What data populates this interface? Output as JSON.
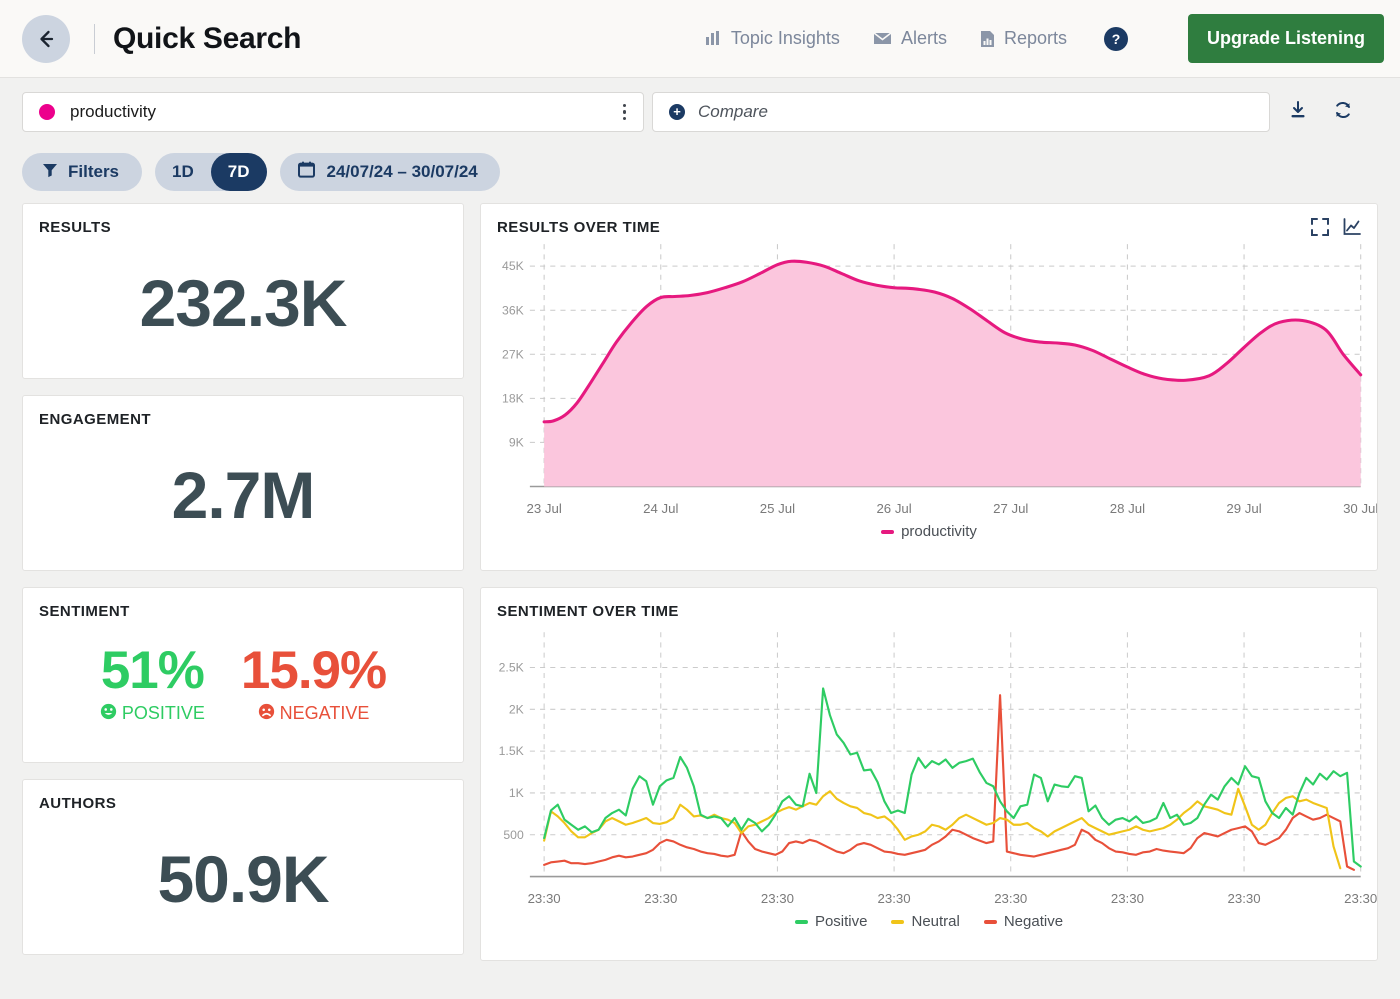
{
  "header": {
    "back_icon": "arrow-left-icon",
    "title": "Quick Search",
    "nav": [
      {
        "label": "Topic Insights",
        "icon": "bar-chart-icon"
      },
      {
        "label": "Alerts",
        "icon": "envelope-icon"
      },
      {
        "label": "Reports",
        "icon": "document-chart-icon"
      }
    ],
    "help_label": "?",
    "upgrade_label": "Upgrade Listening"
  },
  "search": {
    "term": "productivity",
    "term_color": "#ec008c",
    "menu_icon": "kebab-menu-icon",
    "compare_placeholder": "Compare",
    "compare_icon": "plus-circle-icon",
    "download_icon": "download-icon",
    "refresh_icon": "refresh-icon"
  },
  "filters": {
    "filters_label": "Filters",
    "filter_icon": "funnel-icon",
    "range_1d": "1D",
    "range_7d": "7D",
    "active_range": "7D",
    "calendar_icon": "calendar-icon",
    "date_range": "24/07/24 – 30/07/24"
  },
  "metrics": [
    {
      "title": "RESULTS",
      "value": "232.3K"
    },
    {
      "title": "ENGAGEMENT",
      "value": "2.7M"
    }
  ],
  "sentiment_card": {
    "title": "SENTIMENT",
    "positive_value": "51%",
    "positive_label": "POSITIVE",
    "positive_icon": "smiley-happy-icon",
    "positive_color": "#2ecc63",
    "negative_value": "15.9%",
    "negative_label": "NEGATIVE",
    "negative_icon": "smiley-sad-icon",
    "negative_color": "#e8503a"
  },
  "authors_card": {
    "title": "AUTHORS",
    "value": "50.9K"
  },
  "results_chart_card": {
    "title": "RESULTS OVER TIME",
    "fullscreen_icon": "expand-icon",
    "charttype_icon": "line-chart-icon"
  },
  "sentiment_chart_card": {
    "title": "SENTIMENT OVER TIME"
  },
  "chart_data": [
    {
      "id": "results-over-time",
      "type": "area",
      "title": "RESULTS OVER TIME",
      "xlabel": "",
      "ylabel": "",
      "grid": true,
      "legend_position": "bottom",
      "ylim": [
        0,
        49500
      ],
      "yticks": [
        9000,
        18000,
        27000,
        36000,
        45000
      ],
      "ytick_labels": [
        "9K",
        "18K",
        "27K",
        "36K",
        "45K"
      ],
      "categories": [
        "23 Jul",
        "24 Jul",
        "25 Jul",
        "26 Jul",
        "27 Jul",
        "28 Jul",
        "29 Jul",
        "30 Jul"
      ],
      "series": [
        {
          "name": "productivity",
          "color": "#e6197f",
          "fill": "#fbc6dd",
          "x": [
            0,
            0.08,
            0.18,
            0.28,
            0.38,
            0.5,
            0.62,
            0.75,
            0.88,
            1.0,
            1.12,
            1.25,
            1.4,
            1.55,
            1.7,
            1.85,
            2.0,
            2.12,
            2.25,
            2.4,
            2.55,
            2.7,
            2.85,
            3.0,
            3.1,
            3.2,
            3.35,
            3.5,
            3.65,
            3.8,
            3.95,
            4.1,
            4.25,
            4.4,
            4.55,
            4.7,
            4.85,
            5.0,
            5.15,
            5.3,
            5.5,
            5.7,
            5.85,
            6.0,
            6.15,
            6.3,
            6.5,
            6.7,
            6.85,
            7.0
          ],
          "values": [
            13200,
            13400,
            14600,
            17000,
            20500,
            25000,
            29500,
            33500,
            36800,
            38600,
            38800,
            39000,
            39600,
            40600,
            41800,
            43500,
            45300,
            46000,
            45800,
            45000,
            43500,
            42000,
            41100,
            40600,
            40500,
            40300,
            39700,
            38400,
            36300,
            33800,
            31400,
            30100,
            29500,
            29300,
            28900,
            27800,
            26100,
            24400,
            22900,
            22000,
            21700,
            22600,
            25100,
            28400,
            31500,
            33500,
            33900,
            32000,
            27000,
            22800
          ]
        }
      ]
    },
    {
      "id": "sentiment-over-time",
      "type": "line",
      "title": "SENTIMENT OVER TIME",
      "xlabel": "",
      "ylabel": "",
      "grid": true,
      "legend_position": "bottom",
      "ylim": [
        0,
        2800
      ],
      "yticks": [
        500,
        1000,
        1500,
        2000,
        2500
      ],
      "ytick_labels": [
        "500",
        "1K",
        "1.5K",
        "2K",
        "2.5K"
      ],
      "xtick_labels": [
        "23:30",
        "23:30",
        "23:30",
        "23:30",
        "23:30",
        "23:30",
        "23:30",
        "23:30"
      ],
      "series": [
        {
          "name": "Positive",
          "color": "#2ecc63",
          "values": [
            460,
            790,
            860,
            680,
            620,
            560,
            600,
            530,
            560,
            700,
            760,
            800,
            730,
            1050,
            1200,
            1140,
            860,
            1080,
            1150,
            1180,
            1430,
            1300,
            1080,
            740,
            700,
            720,
            700,
            600,
            700,
            560,
            690,
            640,
            540,
            620,
            740,
            900,
            960,
            860,
            840,
            1230,
            1000,
            2250,
            1930,
            1700,
            1600,
            1460,
            1480,
            1270,
            1280,
            1130,
            900,
            760,
            790,
            760,
            1220,
            1420,
            1300,
            1380,
            1340,
            1400,
            1300,
            1360,
            1380,
            1410,
            1250,
            1120,
            1080,
            900,
            780,
            700,
            840,
            860,
            1220,
            1180,
            900,
            1100,
            1080,
            1070,
            1200,
            1180,
            780,
            850,
            700,
            620,
            680,
            700,
            660,
            720,
            640,
            660,
            700,
            880,
            700,
            740,
            620,
            640,
            700,
            860,
            980,
            920,
            1080,
            1180,
            1100,
            1320,
            1200,
            1180,
            900,
            760,
            700,
            820,
            740,
            1000,
            1180,
            1100,
            1230,
            1160,
            1260,
            1200,
            1240,
            180,
            120
          ]
        },
        {
          "name": "Neutral",
          "color": "#f0c419",
          "values": [
            430,
            780,
            720,
            640,
            540,
            470,
            470,
            520,
            560,
            660,
            700,
            660,
            620,
            640,
            670,
            700,
            640,
            630,
            650,
            700,
            860,
            800,
            720,
            730,
            700,
            740,
            700,
            680,
            640,
            520,
            600,
            620,
            660,
            700,
            760,
            800,
            830,
            800,
            840,
            880,
            860,
            960,
            1020,
            930,
            880,
            840,
            820,
            760,
            740,
            700,
            720,
            660,
            560,
            440,
            480,
            500,
            540,
            620,
            600,
            560,
            620,
            700,
            740,
            700,
            660,
            620,
            640,
            700,
            680,
            620,
            620,
            640,
            580,
            540,
            480,
            540,
            580,
            620,
            660,
            700,
            620,
            580,
            540,
            500,
            520,
            540,
            560,
            600,
            560,
            540,
            560,
            580,
            620,
            680,
            760,
            820,
            900,
            840,
            820,
            800,
            760,
            740,
            1050,
            840,
            620,
            560,
            620,
            760,
            880,
            940,
            960,
            900,
            920,
            880,
            850,
            820,
            360,
            100
          ]
        },
        {
          "name": "Negative",
          "color": "#e8503a",
          "values": [
            140,
            170,
            180,
            190,
            160,
            160,
            150,
            160,
            180,
            200,
            230,
            250,
            230,
            240,
            260,
            280,
            320,
            400,
            440,
            420,
            380,
            350,
            330,
            300,
            280,
            270,
            250,
            240,
            260,
            540,
            420,
            330,
            300,
            280,
            260,
            300,
            400,
            420,
            400,
            440,
            420,
            380,
            340,
            300,
            280,
            320,
            380,
            400,
            380,
            340,
            300,
            290,
            270,
            260,
            280,
            300,
            320,
            380,
            420,
            480,
            560,
            540,
            500,
            460,
            430,
            400,
            420,
            2170,
            300,
            280,
            260,
            250,
            240,
            260,
            280,
            300,
            320,
            340,
            380,
            560,
            520,
            440,
            400,
            340,
            300,
            290,
            270,
            260,
            290,
            300,
            330,
            310,
            300,
            290,
            280,
            340,
            460,
            520,
            500,
            480,
            520,
            560,
            580,
            600,
            540,
            400,
            380,
            420,
            460,
            560,
            700,
            760,
            720,
            680,
            700,
            740,
            700,
            660,
            120,
            80
          ]
        }
      ]
    }
  ],
  "results_legend": [
    {
      "label": "productivity",
      "color": "#e6197f"
    }
  ],
  "sentiment_legend": [
    {
      "label": "Positive",
      "color": "#2ecc63"
    },
    {
      "label": "Neutral",
      "color": "#f0c419"
    },
    {
      "label": "Negative",
      "color": "#e8503a"
    }
  ]
}
